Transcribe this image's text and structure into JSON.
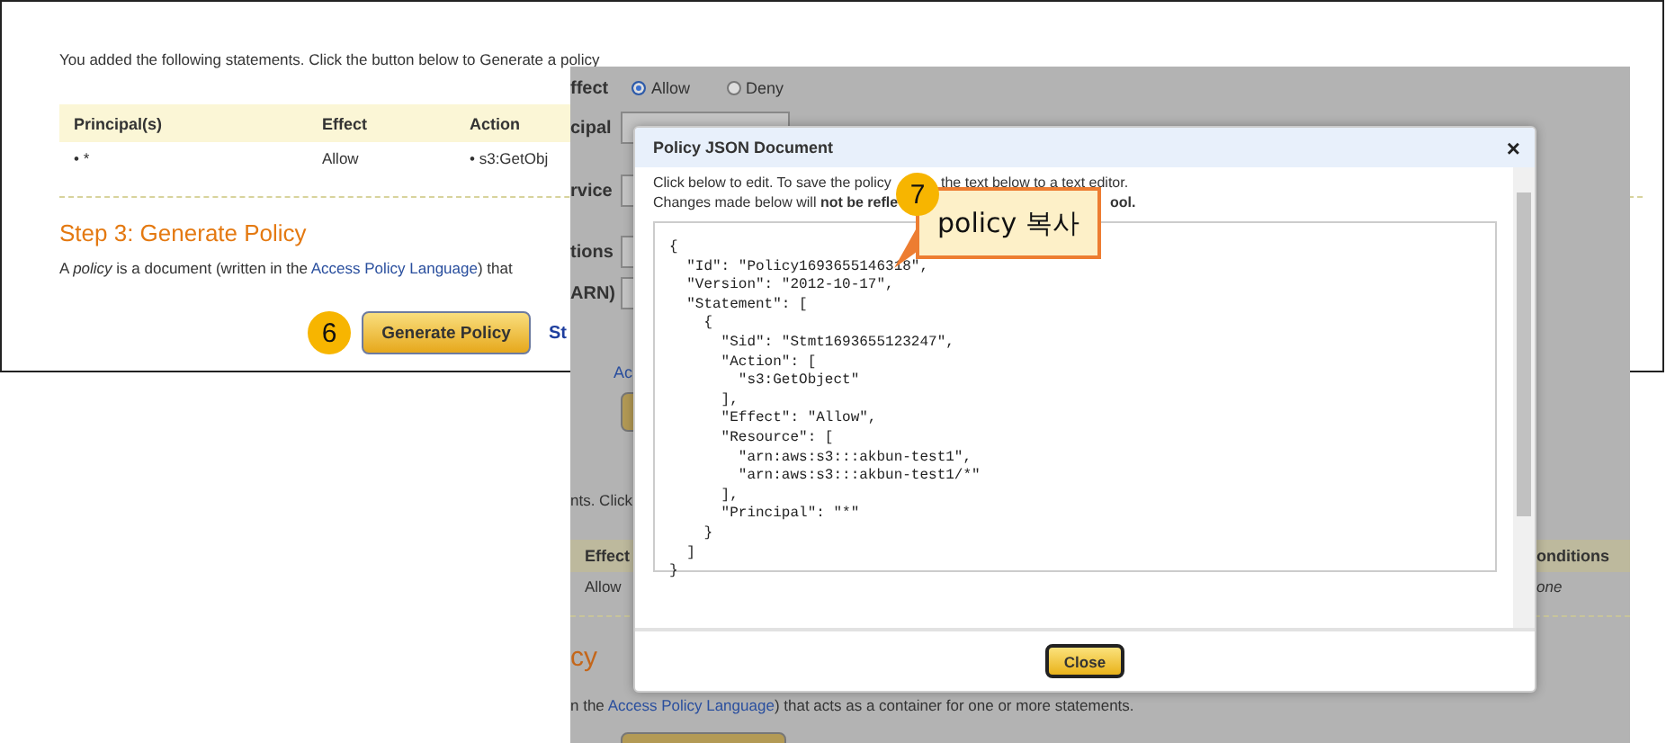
{
  "back_page": {
    "intro": "You added the following statements. Click the button below to Generate a policy",
    "table": {
      "columns": [
        "Principal(s)",
        "Effect",
        "Action"
      ],
      "rows": [
        [
          "• *",
          "Allow",
          "• s3:GetObj"
        ]
      ]
    },
    "heading": "Step 3: Generate Policy",
    "description": {
      "before": "A *policy* is a document (written in the ",
      "link": "Access Policy Language",
      "after": ") that"
    },
    "step_badge": "6",
    "button": "Generate Policy",
    "link_fragment": "St"
  },
  "dimmed_page": {
    "effect_label": "ffect",
    "radios": [
      {
        "label": "Allow",
        "selected": true
      },
      {
        "label": "Deny",
        "selected": false
      }
    ],
    "field_labels": [
      "cipal",
      "rvice",
      "tions",
      "ARN)"
    ],
    "add_link": "Ac",
    "intro_fragment": "nts. Click",
    "table": {
      "columns": [
        "Effect",
        "onditions"
      ],
      "rows": [
        [
          "Allow",
          "one"
        ]
      ]
    },
    "heading_fragment": "cy",
    "description": {
      "before": "n the ",
      "link": "Access Policy Language",
      "after": ") that acts as a container for one or more statements."
    }
  },
  "modal": {
    "title": "Policy JSON Document",
    "close": "×",
    "instructions": [
      {
        "left": "Click below to edit. To save the policy",
        "right": "the text below to a text editor."
      },
      {
        "left": "Changes made below will **not be refle**",
        "right": "**ool.**"
      }
    ],
    "json_text": "{\n  \"Id\": \"Policy1693655146318\",\n  \"Version\": \"2012-10-17\",\n  \"Statement\": [\n    {\n      \"Sid\": \"Stmt1693655123247\",\n      \"Action\": [\n        \"s3:GetObject\"\n      ],\n      \"Effect\": \"Allow\",\n      \"Resource\": [\n        \"arn:aws:s3:::akbun-test1\",\n        \"arn:aws:s3:::akbun-test1/*\"\n      ],\n      \"Principal\": \"*\"\n    }\n  ]\n}",
    "button": "Close"
  },
  "callout": {
    "badge": "7",
    "text": "policy 복사"
  }
}
